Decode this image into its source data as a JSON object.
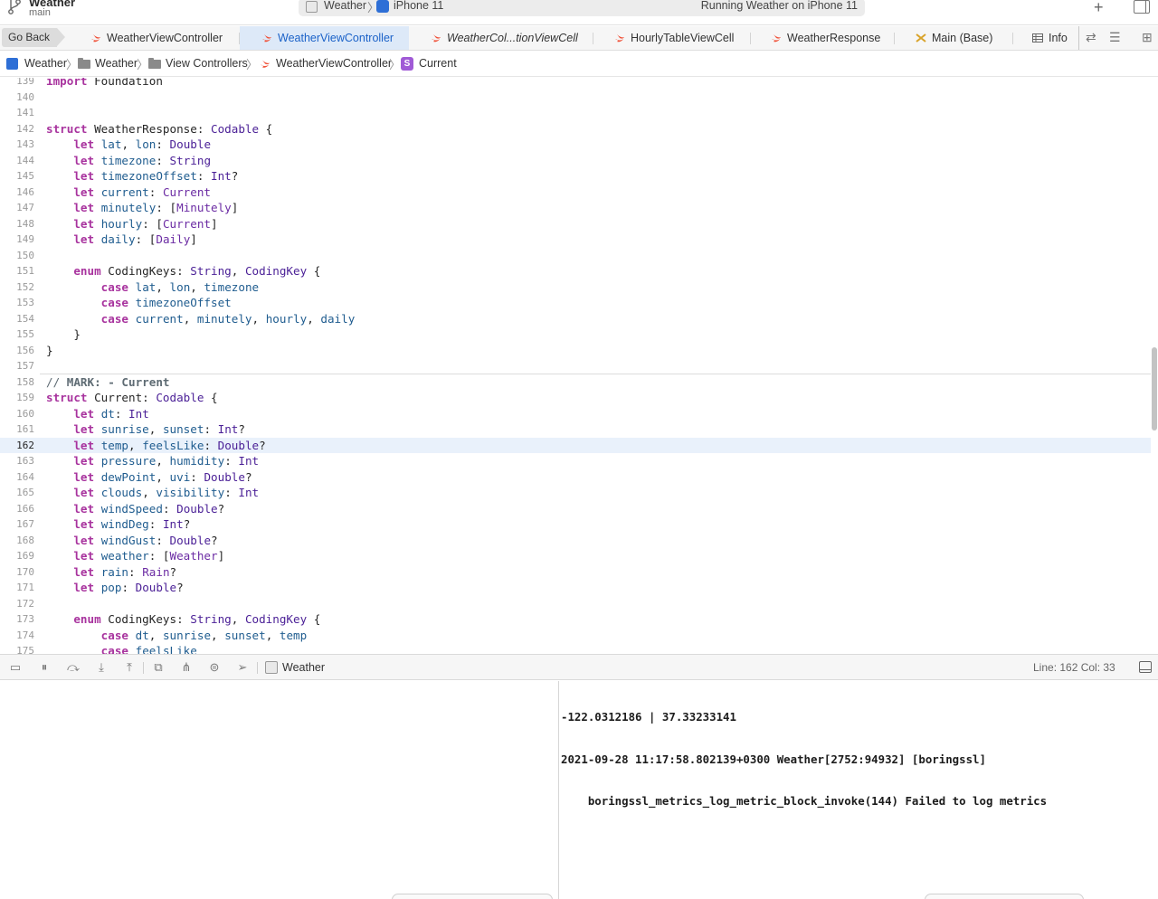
{
  "toolbar": {
    "project_name": "Weather",
    "branch": "main",
    "scheme": "Weather",
    "device": "iPhone 11",
    "status": "Running Weather on iPhone 11"
  },
  "tabs": {
    "go_back": "Go Back",
    "items": [
      {
        "label": "WeatherViewController",
        "icon": "swift-file-icon",
        "active": false,
        "italic": false
      },
      {
        "label": "WeatherViewController",
        "icon": "swift-file-icon",
        "active": true,
        "italic": false
      },
      {
        "label": "WeatherCol...tionViewCell",
        "icon": "swift-file-icon",
        "active": false,
        "italic": true
      },
      {
        "label": "HourlyTableViewCell",
        "icon": "swift-file-icon",
        "active": false,
        "italic": false
      },
      {
        "label": "WeatherResponse",
        "icon": "swift-file-icon",
        "active": false,
        "italic": false
      },
      {
        "label": "Main (Base)",
        "icon": "storyboard-icon",
        "active": false,
        "italic": false
      },
      {
        "label": "Info",
        "icon": "table-icon",
        "active": false,
        "italic": false
      }
    ]
  },
  "jumpbar": {
    "crumbs": [
      "Weather",
      "Weather",
      "View Controllers",
      "WeatherViewController",
      "Current"
    ],
    "struct_letter": "S"
  },
  "editor": {
    "current_line": 162,
    "lines": [
      {
        "n": 139,
        "html": "<span class=\"kw\">import</span> Foundation"
      },
      {
        "n": 140,
        "html": ""
      },
      {
        "n": 141,
        "html": ""
      },
      {
        "n": 142,
        "html": "<span class=\"kw\">struct</span> WeatherResponse: <span class=\"ty\">Codable</span> {"
      },
      {
        "n": 143,
        "html": "    <span class=\"kw\">let</span> <span class=\"pr\">lat</span>, <span class=\"pr\">lon</span>: <span class=\"ty\">Double</span>"
      },
      {
        "n": 144,
        "html": "    <span class=\"kw\">let</span> <span class=\"pr\">timezone</span>: <span class=\"ty\">String</span>"
      },
      {
        "n": 145,
        "html": "    <span class=\"kw\">let</span> <span class=\"pr\">timezoneOffset</span>: <span class=\"ty\">Int</span>?"
      },
      {
        "n": 146,
        "html": "    <span class=\"kw\">let</span> <span class=\"pr\">current</span>: <span class=\"ty2\">Current</span>"
      },
      {
        "n": 147,
        "html": "    <span class=\"kw\">let</span> <span class=\"pr\">minutely</span>: [<span class=\"ty2\">Minutely</span>]"
      },
      {
        "n": 148,
        "html": "    <span class=\"kw\">let</span> <span class=\"pr\">hourly</span>: [<span class=\"ty2\">Current</span>]"
      },
      {
        "n": 149,
        "html": "    <span class=\"kw\">let</span> <span class=\"pr\">daily</span>: [<span class=\"ty2\">Daily</span>]"
      },
      {
        "n": 150,
        "html": ""
      },
      {
        "n": 151,
        "html": "    <span class=\"kw\">enum</span> CodingKeys: <span class=\"ty\">String</span>, <span class=\"ty\">CodingKey</span> {"
      },
      {
        "n": 152,
        "html": "        <span class=\"kw\">case</span> <span class=\"pr\">lat</span>, <span class=\"pr\">lon</span>, <span class=\"pr\">timezone</span>"
      },
      {
        "n": 153,
        "html": "        <span class=\"kw\">case</span> <span class=\"pr\">timezoneOffset</span>"
      },
      {
        "n": 154,
        "html": "        <span class=\"kw\">case</span> <span class=\"pr\">current</span>, <span class=\"pr\">minutely</span>, <span class=\"pr\">hourly</span>, <span class=\"pr\">daily</span>"
      },
      {
        "n": 155,
        "html": "    }"
      },
      {
        "n": 156,
        "html": "}"
      },
      {
        "n": 157,
        "html": ""
      },
      {
        "n": 158,
        "html": "<span class=\"cm\">// </span><span class=\"cmb\">MARK: - Current</span>"
      },
      {
        "n": 159,
        "html": "<span class=\"kw\">struct</span> Current: <span class=\"ty\">Codable</span> {"
      },
      {
        "n": 160,
        "html": "    <span class=\"kw\">let</span> <span class=\"pr\">dt</span>: <span class=\"ty\">Int</span>"
      },
      {
        "n": 161,
        "html": "    <span class=\"kw\">let</span> <span class=\"pr\">sunrise</span>, <span class=\"pr\">sunset</span>: <span class=\"ty\">Int</span>?"
      },
      {
        "n": 162,
        "html": "    <span class=\"kw\">let</span> <span class=\"pr\">temp</span>, <span class=\"pr\">feelsLike</span>: <span class=\"ty\">Double</span>?"
      },
      {
        "n": 163,
        "html": "    <span class=\"kw\">let</span> <span class=\"pr\">pressure</span>, <span class=\"pr\">humidity</span>: <span class=\"ty\">Int</span>"
      },
      {
        "n": 164,
        "html": "    <span class=\"kw\">let</span> <span class=\"pr\">dewPoint</span>, <span class=\"pr\">uvi</span>: <span class=\"ty\">Double</span>?"
      },
      {
        "n": 165,
        "html": "    <span class=\"kw\">let</span> <span class=\"pr\">clouds</span>, <span class=\"pr\">visibility</span>: <span class=\"ty\">Int</span>"
      },
      {
        "n": 166,
        "html": "    <span class=\"kw\">let</span> <span class=\"pr\">windSpeed</span>: <span class=\"ty\">Double</span>?"
      },
      {
        "n": 167,
        "html": "    <span class=\"kw\">let</span> <span class=\"pr\">windDeg</span>: <span class=\"ty\">Int</span>?"
      },
      {
        "n": 168,
        "html": "    <span class=\"kw\">let</span> <span class=\"pr\">windGust</span>: <span class=\"ty\">Double</span>?"
      },
      {
        "n": 169,
        "html": "    <span class=\"kw\">let</span> <span class=\"pr\">weather</span>: [<span class=\"ty2\">Weather</span>]"
      },
      {
        "n": 170,
        "html": "    <span class=\"kw\">let</span> <span class=\"pr\">rain</span>: <span class=\"ty2\">Rain</span>?"
      },
      {
        "n": 171,
        "html": "    <span class=\"kw\">let</span> <span class=\"pr\">pop</span>: <span class=\"ty\">Double</span>?"
      },
      {
        "n": 172,
        "html": ""
      },
      {
        "n": 173,
        "html": "    <span class=\"kw\">enum</span> CodingKeys: <span class=\"ty\">String</span>, <span class=\"ty\">CodingKey</span> {"
      },
      {
        "n": 174,
        "html": "        <span class=\"kw\">case</span> <span class=\"pr\">dt</span>, <span class=\"pr\">sunrise</span>, <span class=\"pr\">sunset</span>, <span class=\"pr\">temp</span>"
      },
      {
        "n": 175,
        "html": "        <span class=\"kw\">case</span> <span class=\"pr\">feelsLike</span>"
      }
    ]
  },
  "debugbar": {
    "process": "Weather",
    "line_col": "Line: 162  Col: 33"
  },
  "console": {
    "lines": [
      "-122.0312186 | 37.33233141",
      "2021-09-28 11:17:58.802139+0300 Weather[2752:94932] [boringssl]",
      "    boringssl_metrics_log_metric_block_invoke(144) Failed to log metrics"
    ]
  },
  "colors": {
    "keyword": "#a8339e",
    "type": "#4a1f96",
    "property": "#1f5c8f",
    "active_tab": "#1b62c8",
    "current_line_bg": "#e9f1fb"
  }
}
